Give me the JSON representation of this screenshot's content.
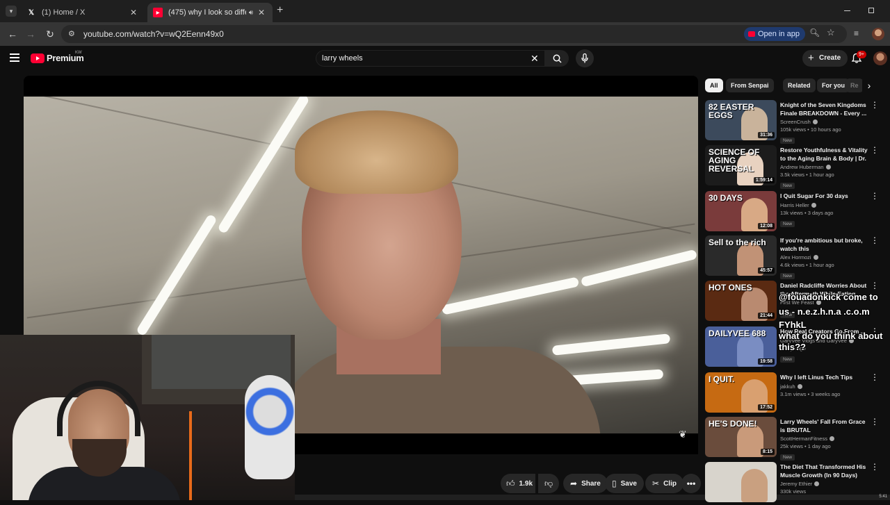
{
  "browser": {
    "tabs": [
      {
        "title": "(1) Home / X",
        "favicon": "x-logo-icon"
      },
      {
        "title": "(475) why I look so differen",
        "favicon": "youtube-icon",
        "audio": "speaker-icon"
      }
    ],
    "new_tab_label": "+",
    "url": "youtube.com/watch?v=wQ2Eenn49x0",
    "open_in_app_label": "Open in app"
  },
  "youtube": {
    "brand": "Premium",
    "region": "KW",
    "search_value": "larry wheels",
    "create_label": "Create",
    "notifications_badge": "9+"
  },
  "actions": {
    "like_count": "1.9k",
    "share_label": "Share",
    "save_label": "Save",
    "clip_label": "Clip"
  },
  "sidebar": {
    "chips": [
      "All",
      "From Senpai",
      "Related",
      "For you",
      "Re"
    ],
    "videos": [
      {
        "title": "Knight of the Seven Kingdoms Finale BREAKDOWN - Every ...",
        "channel": "ScreenCrush",
        "stats": "105k views • 10 hours ago",
        "badge": "New",
        "duration": "31:36",
        "thumb_text": "82 EASTER EGGS",
        "thumb_color": "#3c4a5c"
      },
      {
        "title": "Restore Youthfulness & Vitality to the Aging Brain & Body | Dr. ...",
        "channel": "Andrew Huberman",
        "stats": "3.5k views • 1 hour ago",
        "badge": "New",
        "duration": "1:59:14",
        "thumb_text": "SCIENCE OF AGING REVERSAL",
        "thumb_color": "#1c1c1c"
      },
      {
        "title": "I Quit Sugar For 30 days",
        "channel": "Harris Heller",
        "stats": "13k views • 3 days ago",
        "badge": "New",
        "duration": "12:08",
        "thumb_text": "30 DAYS",
        "thumb_color": "#7a3b3b"
      },
      {
        "title": "If you're ambitious but broke, watch this",
        "channel": "Alex Hormozi",
        "stats": "4.6k views • 1 hour ago",
        "badge": "New",
        "duration": "45:57",
        "thumb_text": "Sell to the rich",
        "thumb_color": "#2a2a2a"
      },
      {
        "title": "Daniel Radcliffe Worries About the Aftermath While Eating ...",
        "channel": "First We Feast",
        "stats": "",
        "badge": "New",
        "duration": "21:44",
        "thumb_text": "HOT ONES",
        "thumb_color": "#5a2a12"
      },
      {
        "title": "How Real Creators Go From ...",
        "channel": "GaryVee Vlogs and GaryVee",
        "stats": "4 days ago",
        "badge": "New",
        "duration": "19:58",
        "thumb_text": "DAILYVEE 688",
        "thumb_color": "#4a5f9a"
      },
      {
        "title": "Why I left Linus Tech Tips",
        "channel": "jakkuh",
        "stats": "3.1m views • 3 weeks ago",
        "badge": "",
        "duration": "17:52",
        "thumb_text": "I QUIT.",
        "thumb_color": "#c66a12"
      },
      {
        "title": "Larry Wheels' Fall From Grace is BRUTAL",
        "channel": "ScottHermanFitness",
        "stats": "25k views • 1 day ago",
        "badge": "New",
        "duration": "8:15",
        "thumb_text": "HE'S DONE!",
        "thumb_color": "#6a4c3c"
      },
      {
        "title": "The Diet That Transformed His Muscle Growth (In 90 Days)",
        "channel": "Jeremy Ethier",
        "stats": "330k views",
        "badge": "",
        "duration": "",
        "thumb_text": "",
        "thumb_color": "#d8d4cc"
      }
    ]
  },
  "chat_overlay": {
    "lines": [
      "@fouadonkick come to",
      "us - n.e.z.h.n.a .c.o.m",
      "FYhkL",
      "what do you think about",
      "this??"
    ]
  },
  "taskbar": {
    "clock": "5:41"
  }
}
